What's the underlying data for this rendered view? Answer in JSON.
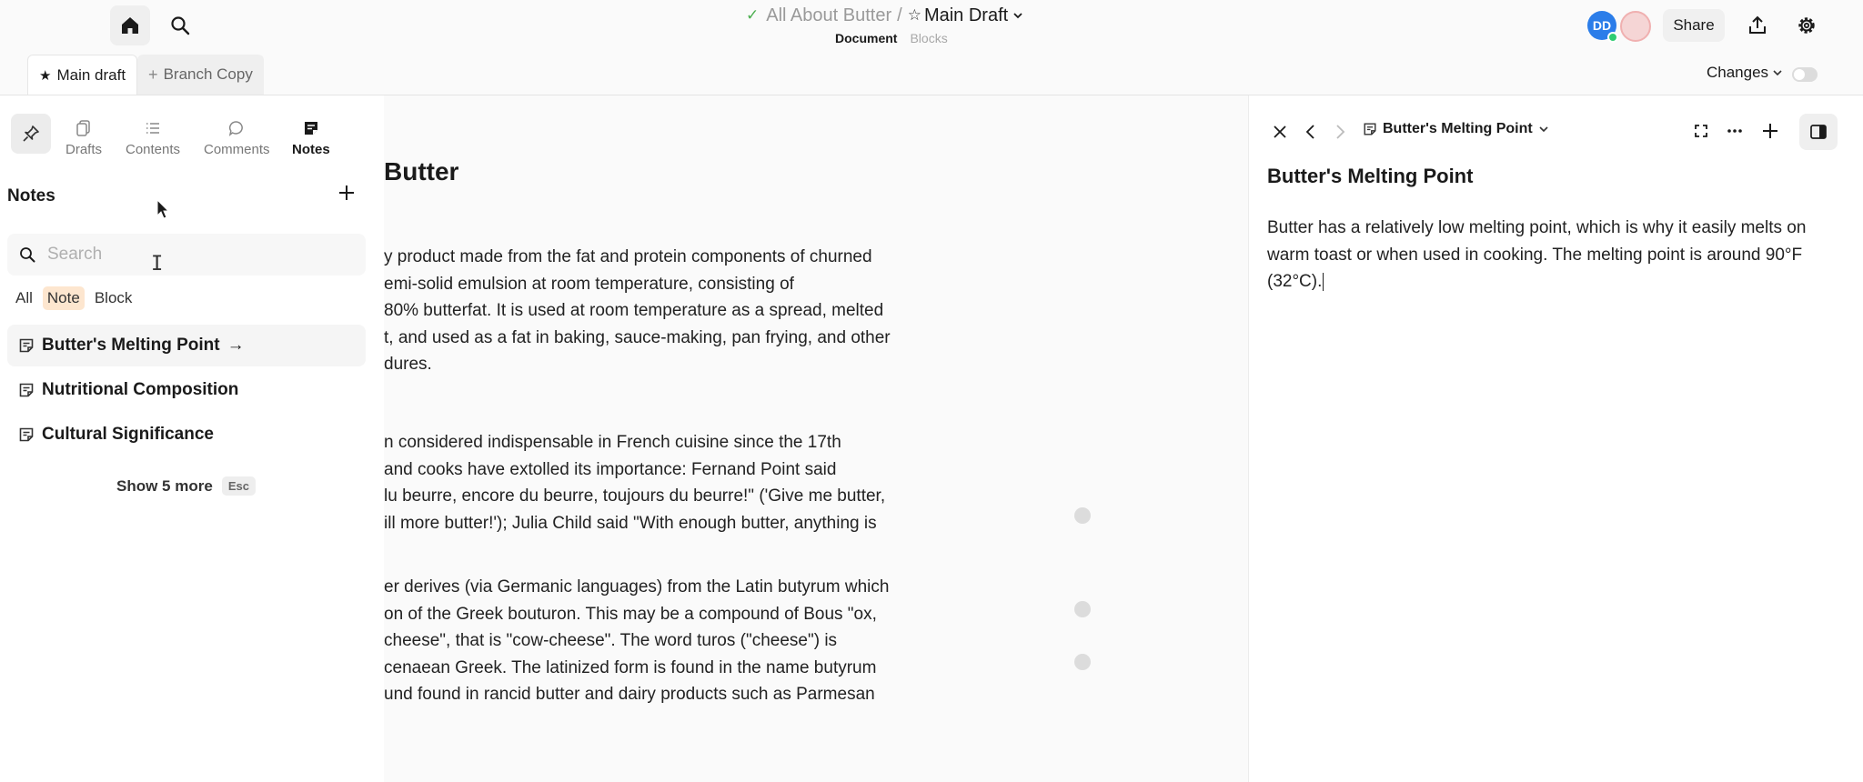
{
  "header": {
    "doc_name": "All About Butter",
    "separator": "/",
    "draft_name": "Main Draft",
    "subtabs": [
      "Document",
      "Blocks"
    ],
    "avatar_initials": "DD",
    "share_label": "Share"
  },
  "tabs": {
    "main_label": "Main draft",
    "branch_label": "Branch Copy"
  },
  "changes_label": "Changes",
  "sidebar": {
    "nav": [
      "Drafts",
      "Contents",
      "Comments",
      "Notes"
    ],
    "notes_title": "Notes",
    "search_placeholder": "Search",
    "filters": [
      "All",
      "Note",
      "Block"
    ],
    "notes": [
      "Butter's Melting Point",
      "Nutritional Composition",
      "Cultural Significance"
    ],
    "arrow": "→",
    "show_more": "Show 5 more",
    "esc": "Esc"
  },
  "document": {
    "title": "Butter",
    "paragraph_1": [
      "y product made from the fat and protein components of churned",
      "emi-solid emulsion at room temperature, consisting of",
      "80% butterfat. It is used at room temperature as a spread, melted",
      "t, and used as a fat in baking, sauce-making, pan frying, and other",
      "dures."
    ],
    "paragraph_2": [
      "n considered indispensable in French cuisine since the 17th",
      " and cooks have extolled its importance: Fernand Point said",
      "lu beurre, encore du beurre, toujours du beurre!\" ('Give me butter,",
      "ill more butter!'); Julia Child said \"With enough butter, anything is"
    ],
    "paragraph_3": [
      "er derives (via Germanic languages) from the Latin butyrum which",
      "on of the Greek bouturon. This may be a compound of Bous \"ox,",
      "cheese\", that is \"cow-cheese\". The word turos (\"cheese\") is",
      "cenaean Greek. The latinized form is found in the name butyrum",
      "und found in rancid butter and dairy products such as Parmesan"
    ]
  },
  "panel": {
    "crumb": "Butter's Melting Point",
    "title": "Butter's Melting Point",
    "body": "Butter has a relatively low melting point, which is why it easily melts on warm toast or when used in cooking. The melting point is around 90°F (32°C)."
  },
  "colors": {
    "accent_blue": "#2b7de9",
    "note_filter_bg": "#fde6cf",
    "check_green": "#4caf50"
  }
}
